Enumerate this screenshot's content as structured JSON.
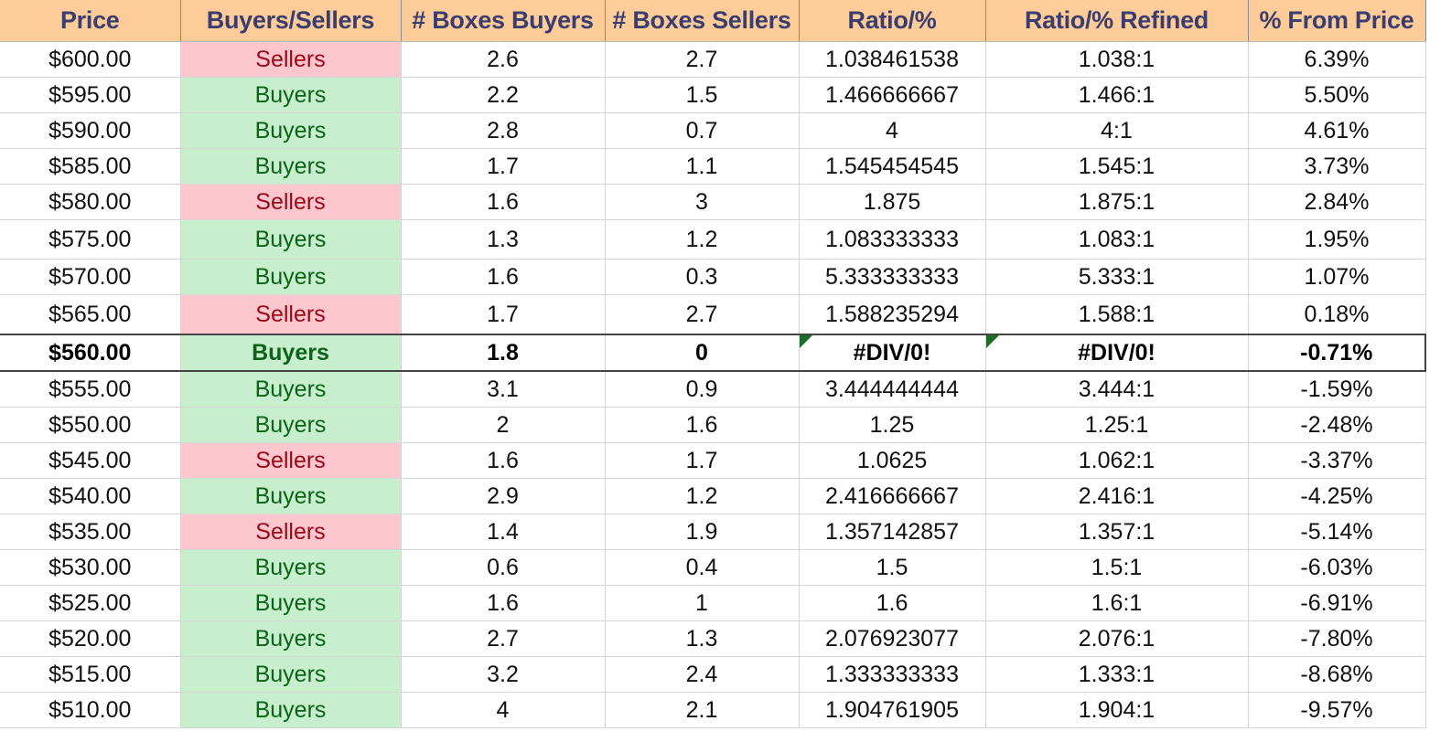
{
  "headers": [
    "Price",
    "Buyers/Sellers",
    "# Boxes Buyers",
    "# Boxes Sellers",
    "Ratio/%",
    "Ratio/% Refined",
    "% From Price"
  ],
  "rows": [
    [
      "$600.00",
      "Sellers",
      "2.6",
      "2.7",
      "1.038461538",
      "1.038:1",
      "6.39%"
    ],
    [
      "$595.00",
      "Buyers",
      "2.2",
      "1.5",
      "1.466666667",
      "1.466:1",
      "5.50%"
    ],
    [
      "$590.00",
      "Buyers",
      "2.8",
      "0.7",
      "4",
      "4:1",
      "4.61%"
    ],
    [
      "$585.00",
      "Buyers",
      "1.7",
      "1.1",
      "1.545454545",
      "1.545:1",
      "3.73%"
    ],
    [
      "$580.00",
      "Sellers",
      "1.6",
      "3",
      "1.875",
      "1.875:1",
      "2.84%"
    ],
    [
      "$575.00",
      "Buyers",
      "1.3",
      "1.2",
      "1.083333333",
      "1.083:1",
      "1.95%"
    ],
    [
      "$570.00",
      "Buyers",
      "1.6",
      "0.3",
      "5.333333333",
      "5.333:1",
      "1.07%"
    ],
    [
      "$565.00",
      "Sellers",
      "1.7",
      "2.7",
      "1.588235294",
      "1.588:1",
      "0.18%"
    ],
    [
      "$560.00",
      "Buyers",
      "1.8",
      "0",
      "#DIV/0!",
      "#DIV/0!",
      "-0.71%"
    ],
    [
      "$555.00",
      "Buyers",
      "3.1",
      "0.9",
      "3.444444444",
      "3.444:1",
      "-1.59%"
    ],
    [
      "$550.00",
      "Buyers",
      "2",
      "1.6",
      "1.25",
      "1.25:1",
      "-2.48%"
    ],
    [
      "$545.00",
      "Sellers",
      "1.6",
      "1.7",
      "1.0625",
      "1.062:1",
      "-3.37%"
    ],
    [
      "$540.00",
      "Buyers",
      "2.9",
      "1.2",
      "2.416666667",
      "2.416:1",
      "-4.25%"
    ],
    [
      "$535.00",
      "Sellers",
      "1.4",
      "1.9",
      "1.357142857",
      "1.357:1",
      "-5.14%"
    ],
    [
      "$530.00",
      "Buyers",
      "0.6",
      "0.4",
      "1.5",
      "1.5:1",
      "-6.03%"
    ],
    [
      "$525.00",
      "Buyers",
      "1.6",
      "1",
      "1.6",
      "1.6:1",
      "-6.91%"
    ],
    [
      "$520.00",
      "Buyers",
      "2.7",
      "1.3",
      "2.076923077",
      "2.076:1",
      "-7.80%"
    ],
    [
      "$515.00",
      "Buyers",
      "3.2",
      "2.4",
      "1.333333333",
      "1.333:1",
      "-8.68%"
    ],
    [
      "$510.00",
      "Buyers",
      "4",
      "2.1",
      "1.904761905",
      "1.904:1",
      "-9.57%"
    ]
  ],
  "current_row_index": 8,
  "colors": {
    "header_bg": "#fdcc99",
    "header_text": "#3b3d6e",
    "buyers_bg": "#c7efce",
    "buyers_text": "#0b6218",
    "sellers_bg": "#fec7ce",
    "sellers_text": "#9c0717",
    "error_indicator": "#1e6b2a"
  }
}
